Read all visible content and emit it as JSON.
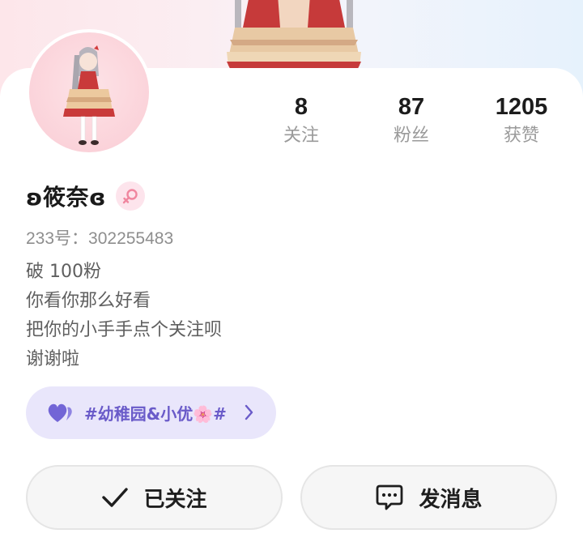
{
  "banner": {
    "image": "banner-character-art"
  },
  "avatar": {
    "image": "avatar-character-art"
  },
  "stats": [
    {
      "value": "8",
      "label": "关注"
    },
    {
      "value": "87",
      "label": "粉丝"
    },
    {
      "value": "1205",
      "label": "获赞"
    }
  ],
  "profile": {
    "username": "ʚ筱奈ɞ",
    "gender_icon": "female-icon",
    "uid": "233号：302255483",
    "bio": [
      "破 100粉",
      "你看你那么好看",
      "把你的小手手点个关注呗",
      "谢谢啦"
    ]
  },
  "tag": {
    "icon": "purple-hearts-icon",
    "text": "#幼稚园&小优🌸#",
    "arrow_icon": "chevron-right-icon"
  },
  "actions": {
    "follow_label": "已关注",
    "follow_icon": "checkmark-icon",
    "message_label": "发消息",
    "message_icon": "message-bubble-icon"
  },
  "colors": {
    "accent_pink": "#f0869f",
    "tag_background": "#e9e6fb",
    "tag_text": "#6a5bc9"
  }
}
